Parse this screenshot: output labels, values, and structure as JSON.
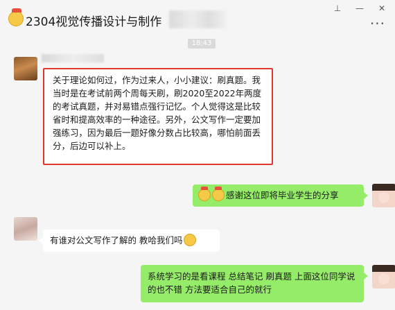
{
  "header": {
    "title": "2304视觉传播设计与制作",
    "title_suffix": "",
    "pin_label": "⊥",
    "minimize_label": "—",
    "close_label": "✕",
    "more_label": "···"
  },
  "timestamp": "18:43",
  "messages": [
    {
      "side": "left",
      "text": "关于理论如何过，作为过来人，小小建议：刷真题。我当时是在考试前两个周每天刷，刷2020至2022年两度的考试真题，并对易错点强行记忆。个人觉得这是比较省时和提高效率的一种途径。另外，公文写作一定要加强练习，因为最后一题好像分数占比较高，哪怕前面丢分，后边可以补上。"
    },
    {
      "side": "right",
      "text": "感谢这位即将毕业学生的分享"
    },
    {
      "side": "left",
      "text": "有谁对公文写作了解的 教哈我们吗"
    },
    {
      "side": "right",
      "text": "系统学习的是看课程 总结笔记  刷真题 上面这位同学说的也不错  方法要适合自己的就行"
    }
  ],
  "icons": [
    "cheer-face-icon",
    "cheer-face-icon",
    "thinking-face-icon"
  ],
  "colors": {
    "bubble_green": "#95ec69",
    "highlight_border": "#e0352b"
  }
}
